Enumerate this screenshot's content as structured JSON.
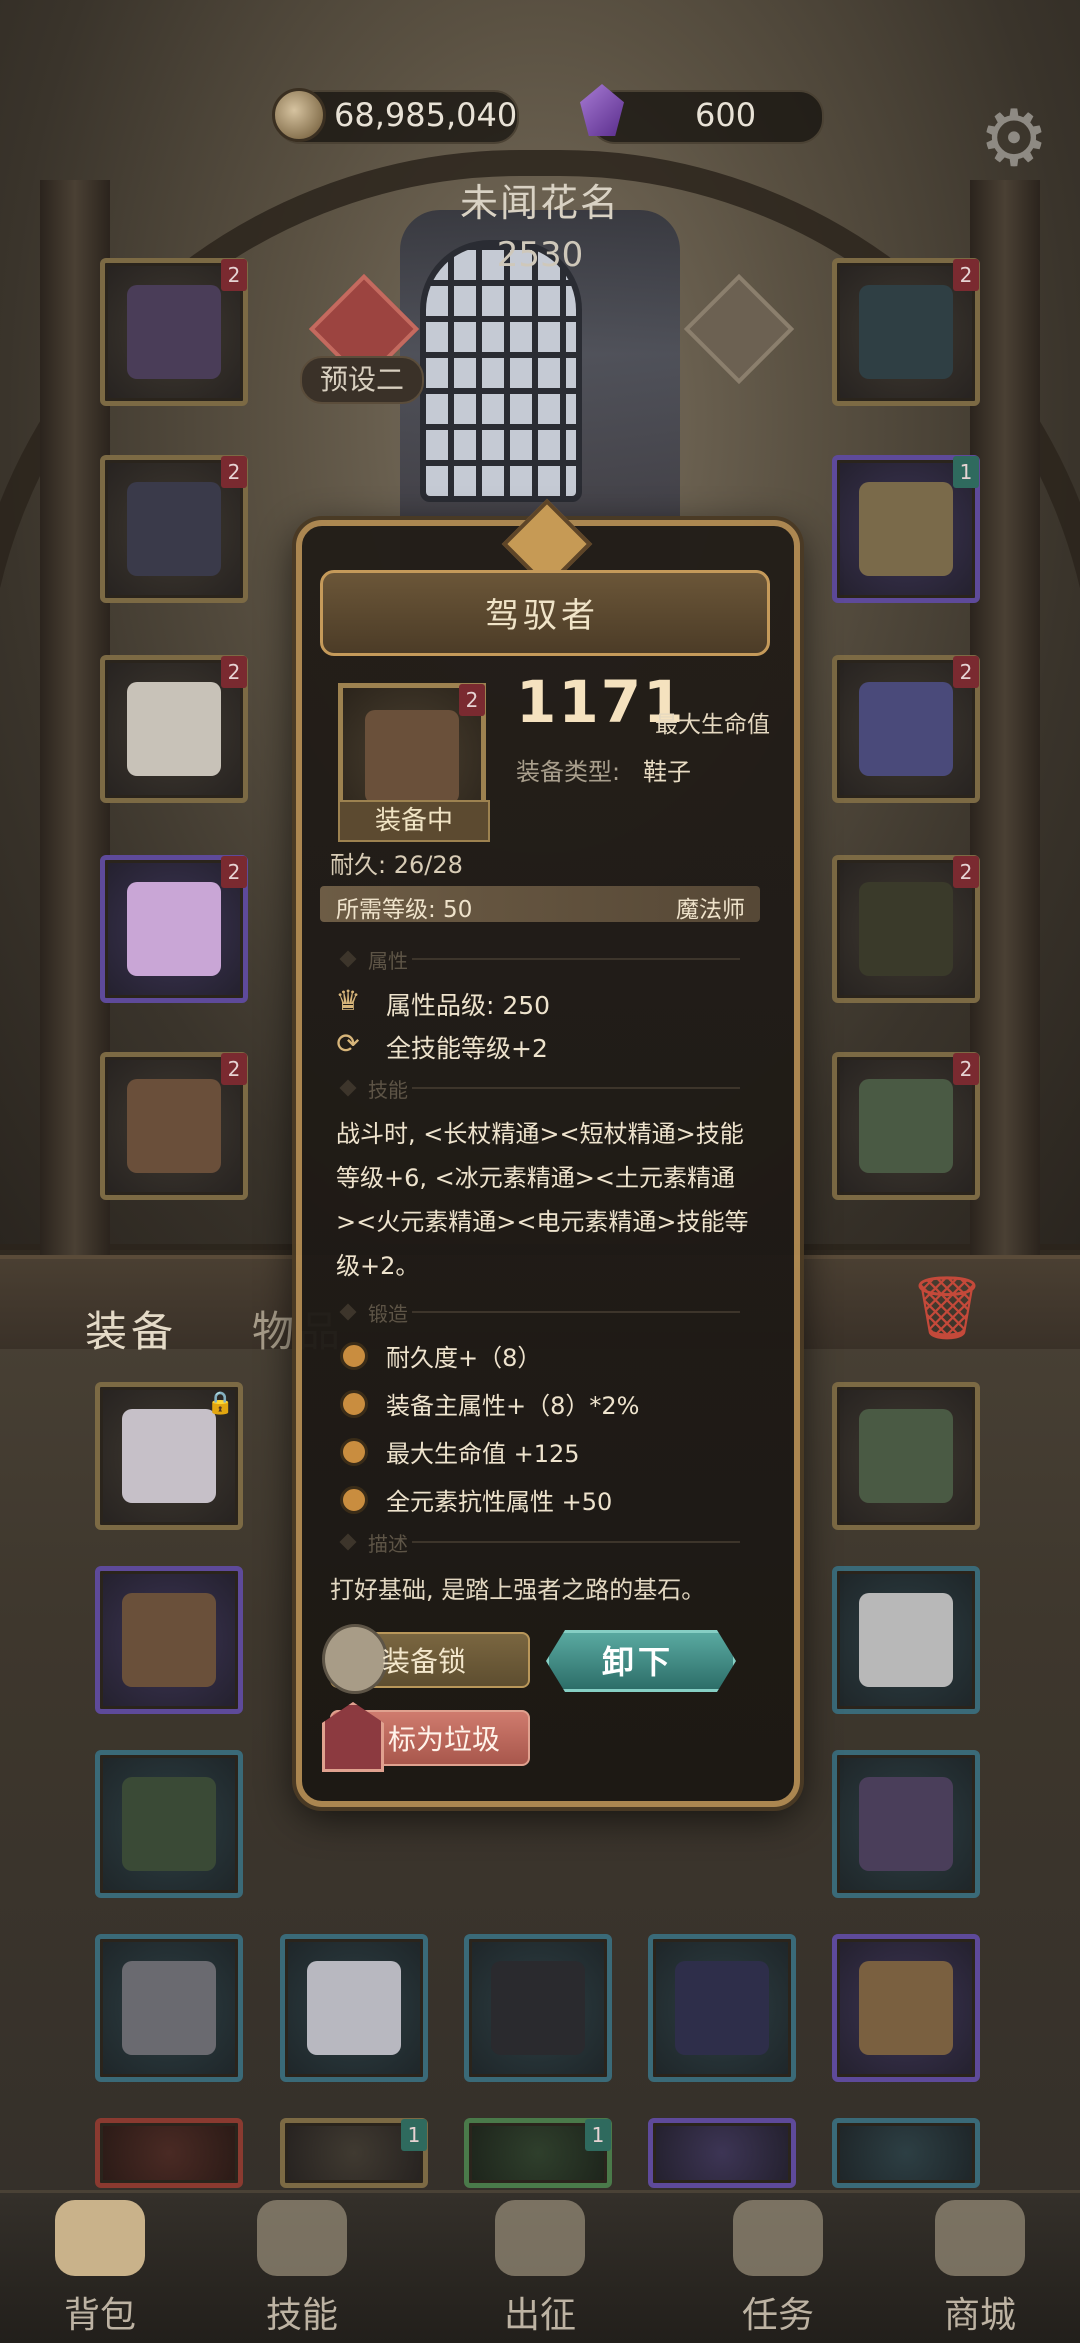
{
  "currency": {
    "gold": "68,985,040",
    "gems": "600"
  },
  "hero": {
    "name": "未闻花名",
    "power": "2530",
    "preset_label": "预设二"
  },
  "tabs": {
    "equipment": "装备",
    "items": "物品"
  },
  "left_slots": [
    {
      "level": "2",
      "rarity": "gold",
      "icon": "cage-helmet-icon"
    },
    {
      "level": "2",
      "rarity": "gold",
      "icon": "dress-armor-icon"
    },
    {
      "level": "2",
      "rarity": "gold",
      "icon": "gloves-icon"
    },
    {
      "level": "2",
      "rarity": "purple",
      "icon": "pants-icon"
    },
    {
      "level": "2",
      "rarity": "gold",
      "icon": "boots-icon"
    }
  ],
  "right_slots": [
    {
      "level": "2",
      "rarity": "gold",
      "icon": "amulet-icon"
    },
    {
      "level": "1",
      "rarity": "purple",
      "icon": "ring-icon"
    },
    {
      "level": "2",
      "rarity": "gold",
      "icon": "ring-icon"
    },
    {
      "level": "2",
      "rarity": "gold",
      "icon": "staff-icon"
    },
    {
      "level": "2",
      "rarity": "gold",
      "icon": "cloak-icon"
    }
  ],
  "popup": {
    "title": "驾驭者",
    "equipped_label": "装备中",
    "item_level": "2",
    "main_stat_value": "1171",
    "main_stat_label": "最大生命值",
    "type_label": "装备类型:",
    "type_value": "鞋子",
    "durability": "耐久: 26/28",
    "required_level": "所需等级: 50",
    "class": "魔法师",
    "section_attributes": "属性",
    "attr_rows": [
      {
        "icon": "crown-icon",
        "text": "属性品级: 250"
      },
      {
        "icon": "cycle-icon",
        "text": "全技能等级+2"
      }
    ],
    "section_skills": "技能",
    "skill_lines": [
      "战斗时, <长杖精通><短杖精通>技能",
      "等级+6, <冰元素精通><土元素精通",
      "><火元素精通><电元素精通>技能等",
      "级+2。"
    ],
    "section_forge": "锻造",
    "forge_rows": [
      "耐久度+（8）",
      "装备主属性+（8）*2%",
      "最大生命值 +125",
      "全元素抗性属性 +50"
    ],
    "section_desc": "描述",
    "description": "打好基础, 是踏上强者之路的基石。",
    "lock_button": "装备锁",
    "unequip_button": "卸下",
    "junk_button": "标为垃圾"
  },
  "bottom_nav": [
    {
      "label": "背包",
      "icon": "backpack-icon"
    },
    {
      "label": "技能",
      "icon": "skill-book-icon"
    },
    {
      "label": "出征",
      "icon": "battle-banner-icon"
    },
    {
      "label": "任务",
      "icon": "quest-icon"
    },
    {
      "label": "商城",
      "icon": "shop-icon"
    }
  ],
  "colors": {
    "gold_frame": "#b08a52",
    "unequip_teal": "#2d6e69",
    "junk_red": "#a8574c",
    "lock_gold": "#7a6640"
  }
}
